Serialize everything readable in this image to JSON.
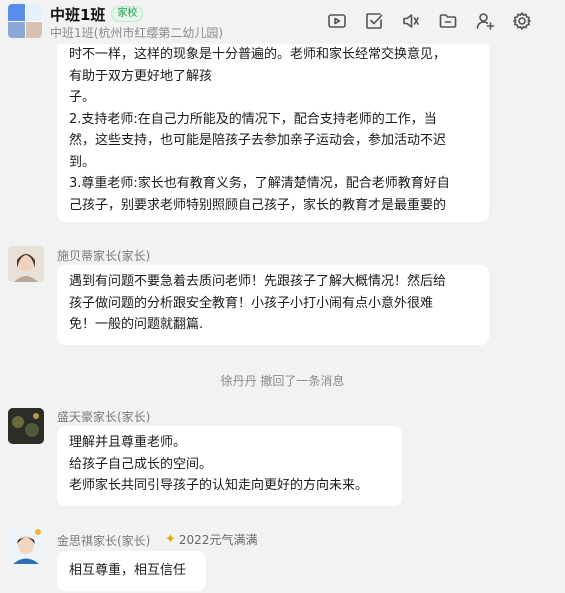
{
  "header": {
    "title": "中班1班",
    "badge": "家校",
    "subtitle": "中班1班(杭州市红缨第二幼儿园)",
    "tools": [
      "video-icon",
      "checkbox-icon",
      "speaker-icon",
      "folder-icon",
      "add-member-icon",
      "settings-icon"
    ]
  },
  "messages": [
    {
      "sender": "",
      "lines": [
        "时不一样，这样的现象是十分普遍的。老师和家长经常交换意见，",
        "有助于双方更好地了解孩",
        "子。",
        "2.支持老师:在自己力所能及的情况下，配合支持老师的工作，当",
        "然，这些支持，也可能是陪孩子去参加亲子运动会，参加活动不迟",
        "到。",
        "3.尊重老师:家长也有教育义务，了解清楚情况，配合老师教育好自",
        "己孩子，别要求老师特别照顾自己孩子，家长的教育才是最重要的"
      ]
    },
    {
      "sender": "施贝蒂家长(家长)",
      "lines": [
        "遇到有问题不要急着去质问老师！先跟孩子了解大概情况！然后给",
        "孩子做问题的分析跟安全教育！小孩子小打小闹有点小意外很难",
        "免！一般的问题就翻篇."
      ]
    },
    {
      "sender": "盛天豪家长(家长)",
      "lines": [
        "理解并且尊重老师。",
        "给孩子自己成长的空间。",
        "老师家长共同引导孩子的认知走向更好的方向未来。"
      ]
    },
    {
      "sender": "金思祺家长(家长)",
      "tag": "2022元气满满",
      "lines": [
        "相互尊重，相互信任"
      ]
    }
  ],
  "system_notice": "徐丹丹 撤回了一条消息",
  "colors": {
    "background": "#f2f2f2",
    "bubble": "#ffffff",
    "badge_green": "#1f9a4a"
  }
}
